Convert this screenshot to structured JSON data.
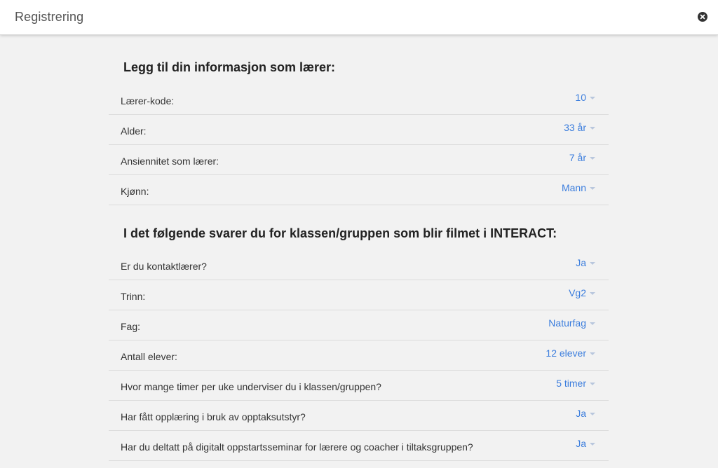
{
  "header": {
    "title": "Registrering"
  },
  "section1": {
    "title": "Legg til din informasjon som lærer:",
    "rows": [
      {
        "label": "Lærer-kode:",
        "value": "10"
      },
      {
        "label": "Alder:",
        "value": "33 år"
      },
      {
        "label": "Ansiennitet som lærer:",
        "value": "7 år"
      },
      {
        "label": "Kjønn:",
        "value": "Mann"
      }
    ]
  },
  "section2": {
    "title": "I det følgende svarer du for klassen/gruppen som blir filmet i INTERACT:",
    "rows": [
      {
        "label": "Er du kontaktlærer?",
        "value": "Ja"
      },
      {
        "label": "Trinn:",
        "value": "Vg2"
      },
      {
        "label": "Fag:",
        "value": "Naturfag"
      },
      {
        "label": "Antall elever:",
        "value": "12 elever"
      },
      {
        "label": "Hvor mange timer per uke underviser du i klassen/gruppen?",
        "value": "5 timer"
      },
      {
        "label": "Har fått opplæring i bruk av opptaksutstyr?",
        "value": "Ja"
      },
      {
        "label": "Har du deltatt på digitalt oppstartsseminar for lærere og coacher i tiltaksgruppen?",
        "value": "Ja"
      }
    ]
  },
  "colors": {
    "accent": "#3b7ddd",
    "background": "#f2f2f2",
    "divider": "#dcdcdc"
  }
}
